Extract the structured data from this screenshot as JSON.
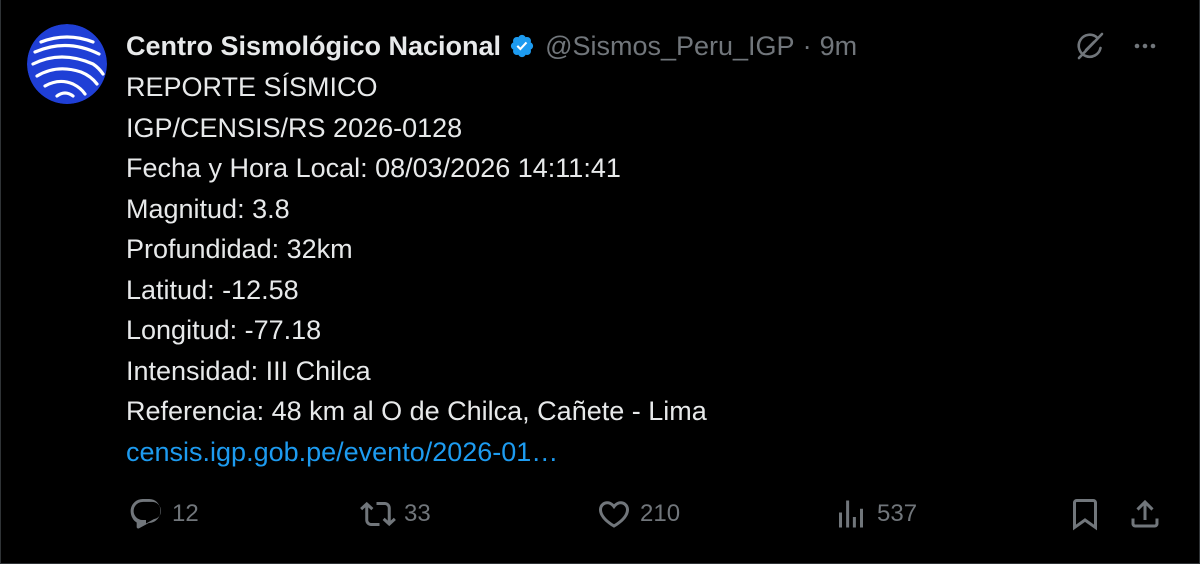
{
  "author": {
    "name": "Centro Sismológico Nacional",
    "handle": "@Sismos_Peru_IGP",
    "separator": "·",
    "time": "9m"
  },
  "icons": {
    "avatar": "igp-logo-avatar",
    "verified": "verified-badge-icon",
    "grok": "grok-icon",
    "more": "more-dots-icon",
    "reply": "reply-icon",
    "repost": "repost-icon",
    "like": "heart-icon",
    "views": "views-icon",
    "bookmark": "bookmark-icon",
    "share": "share-icon"
  },
  "colors": {
    "background": "#000000",
    "text": "#e7e9ea",
    "muted": "#71767b",
    "link": "#1d9bf0",
    "verified": "#1d9bf0",
    "avatar": "#1f3fd6"
  },
  "tweet": {
    "lines": [
      "REPORTE SÍSMICO",
      "IGP/CENSIS/RS 2026-0128",
      "Fecha y Hora Local: 08/03/2026 14:11:41",
      "Magnitud: 3.8",
      "Profundidad: 32km",
      "Latitud: -12.58",
      "Longitud: -77.18",
      "Intensidad: III Chilca",
      "Referencia: 48 km al O de Chilca, Cañete - Lima"
    ],
    "link": "censis.igp.gob.pe/evento/2026-01…"
  },
  "actions": {
    "replies": "12",
    "reposts": "33",
    "likes": "210",
    "views": "537"
  }
}
